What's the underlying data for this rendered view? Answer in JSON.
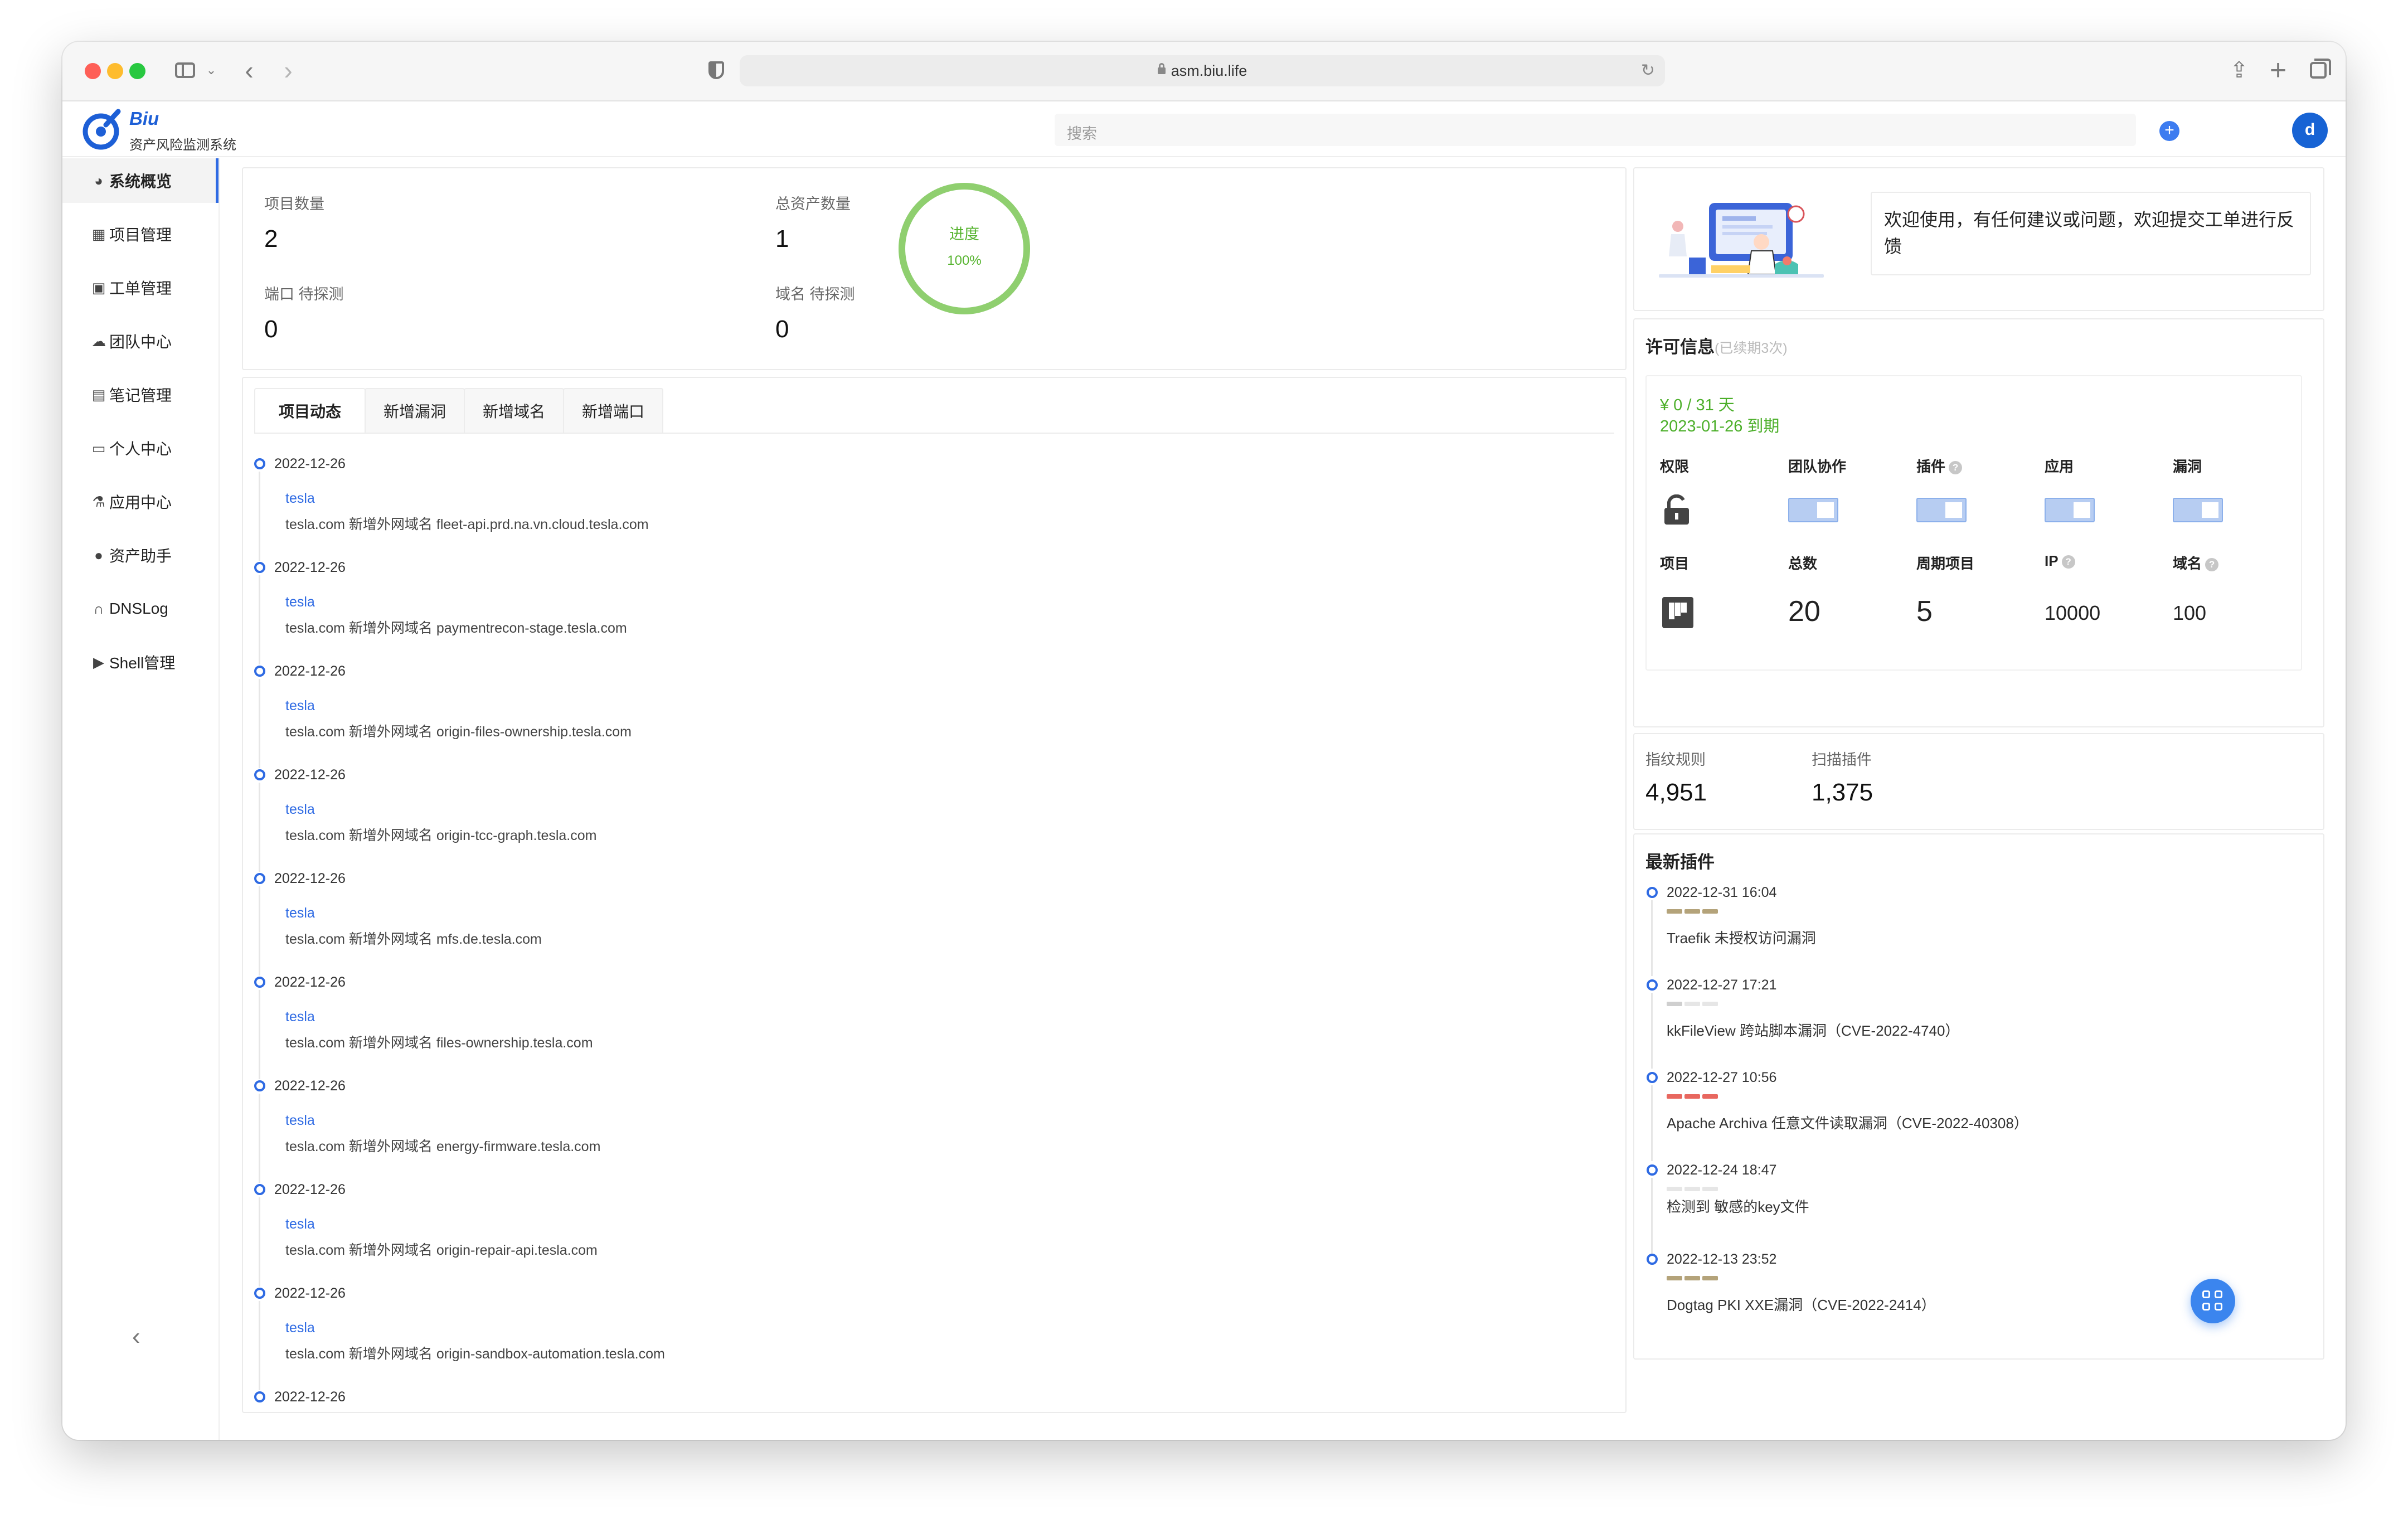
{
  "browser": {
    "url": "asm.biu.life"
  },
  "header": {
    "logo_name": "Biu",
    "logo_subtitle": "资产风险监测系统",
    "search_placeholder": "搜索",
    "plus_label": "+",
    "avatar_letter": "d"
  },
  "sidebar": {
    "items": [
      {
        "label": "系统概览",
        "icon": "pie-chart-icon",
        "glyph": "◕"
      },
      {
        "label": "项目管理",
        "icon": "kanban-icon",
        "glyph": "▦"
      },
      {
        "label": "工单管理",
        "icon": "briefcase-icon",
        "glyph": "▣"
      },
      {
        "label": "团队中心",
        "icon": "team-icon",
        "glyph": "☁"
      },
      {
        "label": "笔记管理",
        "icon": "note-icon",
        "glyph": "▤"
      },
      {
        "label": "个人中心",
        "icon": "id-card-icon",
        "glyph": "▭"
      },
      {
        "label": "应用中心",
        "icon": "flask-icon",
        "glyph": "⚗"
      },
      {
        "label": "资产助手",
        "icon": "bulb-icon",
        "glyph": "●"
      },
      {
        "label": "DNSLog",
        "icon": "headset-icon",
        "glyph": "∩"
      },
      {
        "label": "Shell管理",
        "icon": "terminal-icon",
        "glyph": "▶"
      }
    ]
  },
  "stats": {
    "project_count_label": "项目数量",
    "project_count": "2",
    "asset_total_label": "总资产数量",
    "asset_total": "1",
    "port_pending_label": "端口 待探测",
    "port_pending": "0",
    "domain_pending_label": "域名 待探测",
    "domain_pending": "0",
    "progress_label": "进度",
    "progress_text": "100%",
    "progress": 1.0
  },
  "activity": {
    "tabs": [
      "项目动态",
      "新增漏洞",
      "新增域名",
      "新增端口"
    ],
    "items": [
      {
        "date": "2022-12-26",
        "project": "tesla",
        "desc": "tesla.com 新增外网域名 fleet-api.prd.na.vn.cloud.tesla.com"
      },
      {
        "date": "2022-12-26",
        "project": "tesla",
        "desc": "tesla.com 新增外网域名 paymentrecon-stage.tesla.com"
      },
      {
        "date": "2022-12-26",
        "project": "tesla",
        "desc": "tesla.com 新增外网域名 origin-files-ownership.tesla.com"
      },
      {
        "date": "2022-12-26",
        "project": "tesla",
        "desc": "tesla.com 新增外网域名 origin-tcc-graph.tesla.com"
      },
      {
        "date": "2022-12-26",
        "project": "tesla",
        "desc": "tesla.com 新增外网域名 mfs.de.tesla.com"
      },
      {
        "date": "2022-12-26",
        "project": "tesla",
        "desc": "tesla.com 新增外网域名 files-ownership.tesla.com"
      },
      {
        "date": "2022-12-26",
        "project": "tesla",
        "desc": "tesla.com 新增外网域名 energy-firmware.tesla.com"
      },
      {
        "date": "2022-12-26",
        "project": "tesla",
        "desc": "tesla.com 新增外网域名 origin-repair-api.tesla.com"
      },
      {
        "date": "2022-12-26",
        "project": "tesla",
        "desc": "tesla.com 新增外网域名 origin-sandbox-automation.tesla.com"
      },
      {
        "date": "2022-12-26",
        "project": "",
        "desc": ""
      }
    ]
  },
  "welcome": {
    "text": "欢迎使用，有任何建议或问题，欢迎提交工单进行反馈"
  },
  "license": {
    "title": "许可信息",
    "renewal_note": "(已续期3次)",
    "price": "¥ 0 / 31 天",
    "expire": "2023-01-26 到期",
    "labels": {
      "permission": "权限",
      "team": "团队协作",
      "plugin": "插件",
      "app": "应用",
      "vuln": "漏洞",
      "project": "项目",
      "total": "总数",
      "periodic": "周期项目",
      "ip": "IP",
      "domain": "域名"
    },
    "help_glyph": "?",
    "total": "20",
    "periodic": "5",
    "ip": "10000",
    "domain": "100"
  },
  "rules": {
    "fingerprint_label": "指纹规则",
    "fingerprint": "4,951",
    "plugins_label": "扫描插件",
    "plugins": "1,375"
  },
  "latest_plugins": {
    "title": "最新插件",
    "items": [
      {
        "date": "2022-12-31 16:04",
        "name": "Traefik 未授权访问漏洞",
        "severity_color": "#b4a37a",
        "level": 3
      },
      {
        "date": "2022-12-27 17:21",
        "name": "kkFileView 跨站脚本漏洞（CVE-2022-4740）",
        "severity_color": "#cfcfcf",
        "level": 1
      },
      {
        "date": "2022-12-27 10:56",
        "name": "Apache Archiva 任意文件读取漏洞（CVE-2022-40308）",
        "severity_color": "#e8675f",
        "level": 3
      },
      {
        "date": "2022-12-24 18:47",
        "name": "检测到 敏感的key文件",
        "severity_color": "#e0e0e0",
        "level": 0
      },
      {
        "date": "2022-12-13 23:52",
        "name": "Dogtag PKI XXE漏洞（CVE-2022-2414）",
        "severity_color": "#b4a37a",
        "level": 3
      }
    ]
  },
  "colors": {
    "accent": "#2e6ae3",
    "success": "#57b430"
  }
}
